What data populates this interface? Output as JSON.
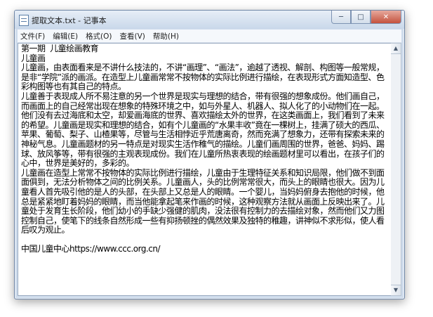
{
  "window": {
    "title": "提取文本.txt - 记事本",
    "controls": {
      "minimize": "─",
      "maximize": "□",
      "close": "✕"
    }
  },
  "menu": {
    "items": [
      {
        "label": "文件(F)"
      },
      {
        "label": "编辑(E)"
      },
      {
        "label": "格式(O)"
      },
      {
        "label": "查看(V)"
      },
      {
        "label": "帮助(H)"
      }
    ]
  },
  "document": {
    "text": "第一期  儿童绘画教育\n儿童画\n儿童画，由表面看来是不讲什么技法的，不讲“画理”、“画法”，逾越了透视、解剖、构图等一般常规，是非“学院”派的画派。在造型上儿童画常常不按物体的实际比例进行描绘，在表现形式方面知造型、色彩构图等也有其自己的特点。\n儿童善于表现成人所不易注意的另一个世界是现实与理想的结合，带有很强的想象成份。他们画自己，而画面上的自己经常出现在想象的特殊环境之中，如与外星人、机器人、拟人化了的小动物们在一起。他们没有去过海底和太空，却爱画海底的世界、喜欢描绘太外的世界，在这类画面上，我们看到了未来的希望。儿童画是现实和理想的结合，如有个儿童画的“水果丰收”竟在一棵树上，挂满了硕大的西瓜、苹果、葡萄、梨子、山楂果等，尽管与生活相悖近乎荒唐离奇，然而充满了想象力，还带有探索未来的神秘气息。儿童画题材的另一特点是对现实生活作稚气的描绘。儿童们画周围的世界，爸爸、妈妈、踢球、放风筝等，带有很强的主观表现成份。我们在儿童所热衷表现的绘画题材里可以看出，在孩子们的心中，世界是美好的，多彩的。\n儿童画在造型上常常不按物体的实际比例进行描绘，儿童由于生理特征关系和知识局限，他们做不到面面俱到，无法分析物体之间的比例关系。儿童画人，头的比例常常很大，而头上的眼睛也很大。因为儿童看人首先吸引他的是人的头部，在头部上又总是人的眼睛。一个婴儿，当妈妈俯身去抱他的时候，他总是紧紧地盯着妈妈的眼睛，而当他能拿起笔来作画的时候，这种观察方法就从画面上反映出来了。儿童处于发育生长阶段，他们幼小的手缺少强健的肌肉，没法很有控制力的去描绘对象，然而他们又力图控制自己，使笔下的线条自然形成一些有抑扬顿挫的偶然效果及独特的稚趣，讲神似不求形似，使人看后叹为观止。\n\n中国儿童中心https://www.ccc.org.cn/"
  }
}
